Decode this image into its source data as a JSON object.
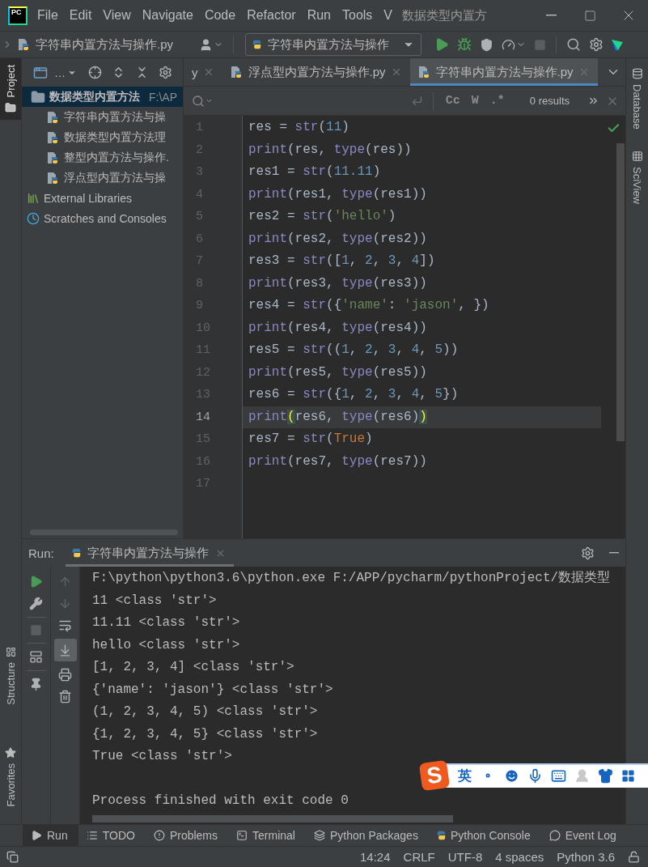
{
  "logo": "PC",
  "menu": [
    "File",
    "Edit",
    "View",
    "Navigate",
    "Code",
    "Refactor",
    "Run",
    "Tools",
    "V"
  ],
  "window_title": "数据类型内置方",
  "toolbar": {
    "breadcrumb": "字符串内置方法与操作.py",
    "run_config": "字符串内置方法与操作"
  },
  "left_stripe": [
    {
      "label": "Project",
      "selected": true,
      "kind": "project"
    },
    {
      "label": "Structure",
      "selected": false,
      "kind": "structure"
    },
    {
      "label": "Favorites",
      "selected": false,
      "kind": "favorites"
    }
  ],
  "project": {
    "view": "…",
    "tree": [
      {
        "label": "数据类型内置方法",
        "path": "F:\\AP",
        "kind": "folder",
        "selected": true,
        "children": [
          {
            "label": "字符串内置方法与操",
            "kind": "python",
            "selected": false
          },
          {
            "label": "数据类型内置方法理",
            "kind": "python",
            "selected": false
          },
          {
            "label": "整型内置方法与操作.",
            "kind": "python",
            "selected": false
          },
          {
            "label": "浮点型内置方法与操",
            "kind": "python",
            "selected": false
          }
        ]
      },
      {
        "label": "External Libraries",
        "kind": "library",
        "selected": false
      },
      {
        "label": "Scratches and Consoles",
        "kind": "scratch",
        "selected": false
      }
    ]
  },
  "right_stripe": [
    {
      "label": "Database",
      "kind": "database"
    },
    {
      "label": "SciView",
      "kind": "sciview"
    }
  ],
  "editor_tabs": [
    {
      "label": "y",
      "selected": false
    },
    {
      "label": "浮点型内置方法与操作.py",
      "selected": false
    },
    {
      "label": "字符串内置方法与操作.py",
      "selected": true
    }
  ],
  "find_bar": {
    "options": [
      "Cc",
      "W",
      ".*"
    ],
    "results": "0 results"
  },
  "code": [
    {
      "number": "1",
      "current": false,
      "tokens": [
        {
          "kind": "plain",
          "text": "res = "
        },
        {
          "kind": "builtin",
          "text": "str"
        },
        {
          "kind": "plain",
          "text": "("
        },
        {
          "kind": "number",
          "text": "11"
        },
        {
          "kind": "plain",
          "text": ")"
        }
      ]
    },
    {
      "number": "2",
      "current": false,
      "tokens": [
        {
          "kind": "builtin",
          "text": "print"
        },
        {
          "kind": "plain",
          "text": "(res, "
        },
        {
          "kind": "builtin",
          "text": "type"
        },
        {
          "kind": "plain",
          "text": "(res))"
        }
      ]
    },
    {
      "number": "3",
      "current": false,
      "tokens": [
        {
          "kind": "plain",
          "text": "res1 = "
        },
        {
          "kind": "builtin",
          "text": "str"
        },
        {
          "kind": "plain",
          "text": "("
        },
        {
          "kind": "number",
          "text": "11.11"
        },
        {
          "kind": "plain",
          "text": ")"
        }
      ]
    },
    {
      "number": "4",
      "current": false,
      "tokens": [
        {
          "kind": "builtin",
          "text": "print"
        },
        {
          "kind": "plain",
          "text": "(res1, "
        },
        {
          "kind": "builtin",
          "text": "type"
        },
        {
          "kind": "plain",
          "text": "(res1))"
        }
      ]
    },
    {
      "number": "5",
      "current": false,
      "tokens": [
        {
          "kind": "plain",
          "text": "res2 = "
        },
        {
          "kind": "builtin",
          "text": "str"
        },
        {
          "kind": "plain",
          "text": "("
        },
        {
          "kind": "string",
          "text": "'hello'"
        },
        {
          "kind": "plain",
          "text": ")"
        }
      ]
    },
    {
      "number": "6",
      "current": false,
      "tokens": [
        {
          "kind": "builtin",
          "text": "print"
        },
        {
          "kind": "plain",
          "text": "(res2, "
        },
        {
          "kind": "builtin",
          "text": "type"
        },
        {
          "kind": "plain",
          "text": "(res2))"
        }
      ]
    },
    {
      "number": "7",
      "current": false,
      "tokens": [
        {
          "kind": "plain",
          "text": "res3 = "
        },
        {
          "kind": "builtin",
          "text": "str"
        },
        {
          "kind": "plain",
          "text": "(["
        },
        {
          "kind": "number",
          "text": "1"
        },
        {
          "kind": "plain",
          "text": ", "
        },
        {
          "kind": "number",
          "text": "2"
        },
        {
          "kind": "plain",
          "text": ", "
        },
        {
          "kind": "number",
          "text": "3"
        },
        {
          "kind": "plain",
          "text": ", "
        },
        {
          "kind": "number",
          "text": "4"
        },
        {
          "kind": "plain",
          "text": "])"
        }
      ]
    },
    {
      "number": "8",
      "current": false,
      "tokens": [
        {
          "kind": "builtin",
          "text": "print"
        },
        {
          "kind": "plain",
          "text": "(res3, "
        },
        {
          "kind": "builtin",
          "text": "type"
        },
        {
          "kind": "plain",
          "text": "(res3))"
        }
      ]
    },
    {
      "number": "9",
      "current": false,
      "tokens": [
        {
          "kind": "plain",
          "text": "res4 = "
        },
        {
          "kind": "builtin",
          "text": "str"
        },
        {
          "kind": "plain",
          "text": "({"
        },
        {
          "kind": "string",
          "text": "'name'"
        },
        {
          "kind": "plain",
          "text": ": "
        },
        {
          "kind": "string",
          "text": "'jason'"
        },
        {
          "kind": "plain",
          "text": ", })"
        }
      ]
    },
    {
      "number": "10",
      "current": false,
      "tokens": [
        {
          "kind": "builtin",
          "text": "print"
        },
        {
          "kind": "plain",
          "text": "(res4, "
        },
        {
          "kind": "builtin",
          "text": "type"
        },
        {
          "kind": "plain",
          "text": "(res4))"
        }
      ]
    },
    {
      "number": "11",
      "current": false,
      "tokens": [
        {
          "kind": "plain",
          "text": "res5 = "
        },
        {
          "kind": "builtin",
          "text": "str"
        },
        {
          "kind": "plain",
          "text": "(("
        },
        {
          "kind": "number",
          "text": "1"
        },
        {
          "kind": "plain",
          "text": ", "
        },
        {
          "kind": "number",
          "text": "2"
        },
        {
          "kind": "plain",
          "text": ", "
        },
        {
          "kind": "number",
          "text": "3"
        },
        {
          "kind": "plain",
          "text": ", "
        },
        {
          "kind": "number",
          "text": "4"
        },
        {
          "kind": "plain",
          "text": ", "
        },
        {
          "kind": "number",
          "text": "5"
        },
        {
          "kind": "plain",
          "text": "))"
        }
      ]
    },
    {
      "number": "12",
      "current": false,
      "tokens": [
        {
          "kind": "builtin",
          "text": "print"
        },
        {
          "kind": "plain",
          "text": "(res5, "
        },
        {
          "kind": "builtin",
          "text": "type"
        },
        {
          "kind": "plain",
          "text": "(res5))"
        }
      ]
    },
    {
      "number": "13",
      "current": false,
      "tokens": [
        {
          "kind": "plain",
          "text": "res6 = "
        },
        {
          "kind": "builtin",
          "text": "str"
        },
        {
          "kind": "plain",
          "text": "({"
        },
        {
          "kind": "number",
          "text": "1"
        },
        {
          "kind": "plain",
          "text": ", "
        },
        {
          "kind": "number",
          "text": "2"
        },
        {
          "kind": "plain",
          "text": ", "
        },
        {
          "kind": "number",
          "text": "3"
        },
        {
          "kind": "plain",
          "text": ", "
        },
        {
          "kind": "number",
          "text": "4"
        },
        {
          "kind": "plain",
          "text": ", "
        },
        {
          "kind": "number",
          "text": "5"
        },
        {
          "kind": "plain",
          "text": "})"
        }
      ]
    },
    {
      "number": "14",
      "current": true,
      "tokens": [
        {
          "kind": "builtin",
          "text": "print"
        },
        {
          "kind": "brace",
          "text": "("
        },
        {
          "kind": "plain",
          "text": "res6, "
        },
        {
          "kind": "builtin",
          "text": "type"
        },
        {
          "kind": "plain",
          "text": "(res6)"
        },
        {
          "kind": "brace",
          "text": ")"
        }
      ]
    },
    {
      "number": "15",
      "current": false,
      "tokens": [
        {
          "kind": "plain",
          "text": "res7 = "
        },
        {
          "kind": "builtin",
          "text": "str"
        },
        {
          "kind": "plain",
          "text": "("
        },
        {
          "kind": "keyword",
          "text": "True"
        },
        {
          "kind": "plain",
          "text": ")"
        }
      ]
    },
    {
      "number": "16",
      "current": false,
      "tokens": [
        {
          "kind": "builtin",
          "text": "print"
        },
        {
          "kind": "plain",
          "text": "(res7, "
        },
        {
          "kind": "builtin",
          "text": "type"
        },
        {
          "kind": "plain",
          "text": "(res7))"
        }
      ]
    },
    {
      "number": "17",
      "current": false
    }
  ],
  "run": {
    "title": "Run:",
    "tab": "字符串内置方法与操作",
    "scroll_to_end": {
      "selected": true
    },
    "output": [
      {
        "kind": "line",
        "text": "F:\\python\\python3.6\\python.exe F:/APP/pycharm/pythonProject/数据类型"
      },
      {
        "kind": "line",
        "text": "11 <class 'str'>"
      },
      {
        "kind": "line",
        "text": "11.11 <class 'str'>"
      },
      {
        "kind": "line",
        "text": "hello <class 'str'>"
      },
      {
        "kind": "line",
        "text": "[1, 2, 3, 4] <class 'str'>"
      },
      {
        "kind": "line",
        "text": "{'name': 'jason'} <class 'str'>"
      },
      {
        "kind": "line",
        "text": "(1, 2, 3, 4, 5) <class 'str'>"
      },
      {
        "kind": "line",
        "text": "{1, 2, 3, 4, 5} <class 'str'>"
      },
      {
        "kind": "line",
        "text": "True <class 'str'>"
      },
      {
        "kind": "exit",
        "text": "Process finished with exit code 0"
      }
    ]
  },
  "ime": {
    "logo": "S",
    "mode": "英"
  },
  "tool_windows": [
    {
      "label": "Run",
      "kind": "run",
      "selected": true
    },
    {
      "label": "TODO",
      "kind": "todo",
      "selected": false
    },
    {
      "label": "Problems",
      "kind": "problems",
      "selected": false
    },
    {
      "label": "Terminal",
      "kind": "terminal",
      "selected": false
    },
    {
      "label": "Python Packages",
      "kind": "packages",
      "selected": false
    },
    {
      "label": "Python Console",
      "kind": "console",
      "selected": false
    },
    {
      "label": "Event Log",
      "kind": "log",
      "selected": false
    }
  ],
  "status": [
    "14:24",
    "CRLF",
    "UTF-8",
    "4 spaces",
    "Python 3.6"
  ]
}
